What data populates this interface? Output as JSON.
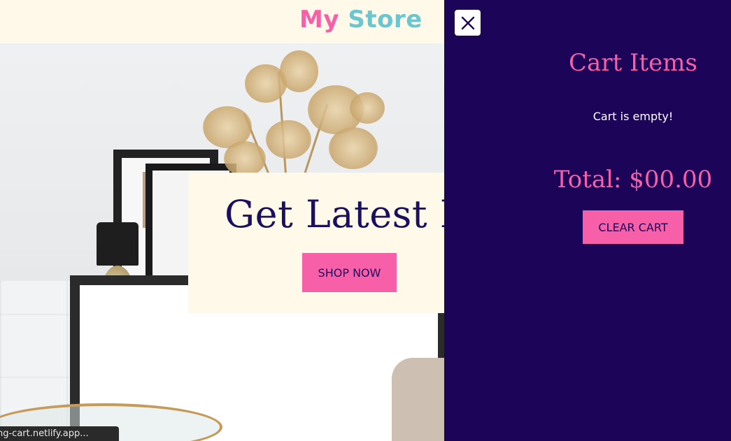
{
  "header": {
    "logo_part1": "My",
    "logo_part2": "Store"
  },
  "hero": {
    "title": "Get Latest Items",
    "button_label": "SHOP NOW"
  },
  "cart": {
    "close_icon": "close-icon",
    "title": "Cart Items",
    "empty_message": "Cart is empty!",
    "total": "Total: $00.00",
    "clear_label": "CLEAR CART"
  },
  "status_bar": {
    "url": "ng-cart.netlify.app..."
  },
  "colors": {
    "pink": "#f75fa8",
    "teal": "#6bc6cf",
    "navy": "#1c0458",
    "cream": "#fef9e8"
  }
}
